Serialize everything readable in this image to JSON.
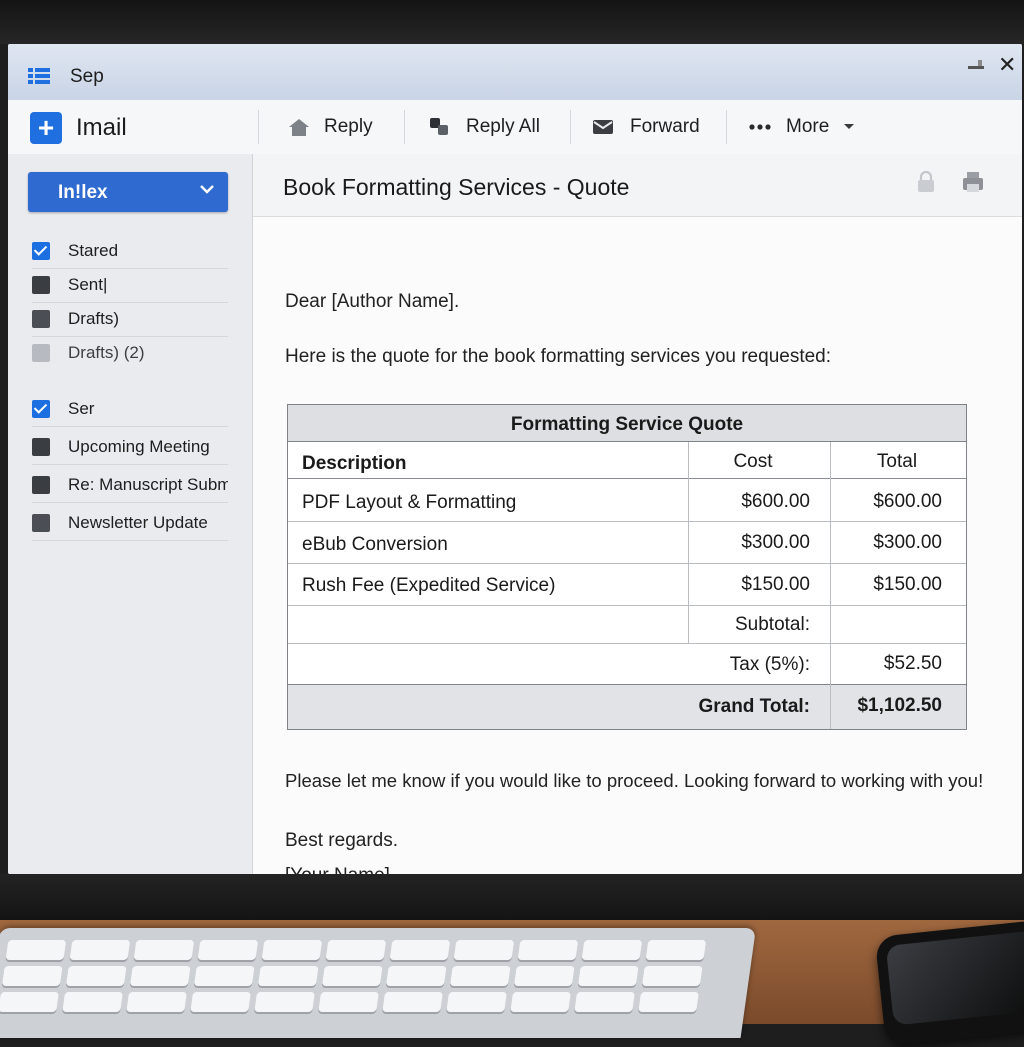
{
  "window": {
    "title": "Sep",
    "close_glyph": "✕"
  },
  "toolbar": {
    "compose_glyph": "+",
    "app_name": "Imail",
    "reply_label": "Reply",
    "reply_all_label": "Reply All",
    "forward_label": "Forward",
    "more_label": "More"
  },
  "sidebar": {
    "folder_selected": "In!lex",
    "items": [
      {
        "label": "Stared",
        "state": "checked"
      },
      {
        "label": "Sent|",
        "state": "dark"
      },
      {
        "label": "Drafts)",
        "state": "mid"
      },
      {
        "label": "Drafts) (2)",
        "state": "light"
      },
      {
        "label": "Ser",
        "state": "checked"
      },
      {
        "label": "Upcoming Meeting",
        "state": "dark"
      },
      {
        "label": "Re: Manuscript Submissic",
        "state": "dark"
      },
      {
        "label": "Newsletter Update",
        "state": "mid"
      }
    ]
  },
  "email": {
    "subject": "Book Formatting Services - Quote",
    "greeting": "Dear [Author Name].",
    "intro": "Here is the quote for the book formatting services you requested:",
    "closing_line": "Please let me know if you would like to proceed. Looking forward to working with you!",
    "signoff": "Best regards.",
    "signature": "[Your Name]"
  },
  "quote_table": {
    "title": "Formatting Service Quote",
    "headers": [
      "Description",
      "Cost",
      "Total"
    ],
    "rows": [
      {
        "description": "PDF Layout & Formatting",
        "cost": "$600.00",
        "total": "$600.00"
      },
      {
        "description": "eBub Conversion",
        "cost": "$300.00",
        "total": "$300.00"
      },
      {
        "description": "Rush Fee (Expedited Service)",
        "cost": "$150.00",
        "total": "$150.00"
      }
    ],
    "subtotal_label": "Subtotal:",
    "subtotal_value": "",
    "tax_label": "Tax (5%):",
    "tax_value": "$52.50",
    "grand_total_label": "Grand Total:",
    "grand_total_value": "$1,102.50"
  },
  "colors": {
    "accent": "#1f6fe0",
    "folder_select": "#2f6ad0"
  }
}
